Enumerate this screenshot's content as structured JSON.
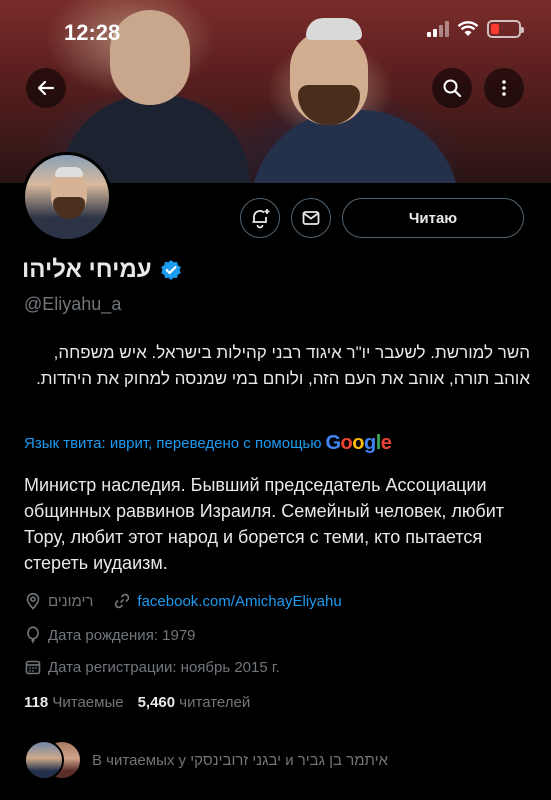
{
  "status_bar": {
    "time": "12:28"
  },
  "header": {
    "back_icon": "arrow-left-icon",
    "search_icon": "search-icon",
    "more_icon": "more-vertical-icon"
  },
  "profile": {
    "display_name": "עמיחי אליהו",
    "handle": "@Eliyahu_a",
    "follow_label": "Читаю",
    "bio_original": "השר למורשת. לשעבר יו\"ר איגוד רבני קהילות בישראל. איש משפחה, אוהב תורה, אוהב את העם הזה, ולוחם במי שמנסה למחוק את היהדות.",
    "translation_note": "Язык твита: иврит, переведено с помощью",
    "translation_brand": "Google",
    "bio_translated": "Министр наследия. Бывший председатель Ассоциации общинных раввинов Израиля. Семейный человек, любит Тору, любит этот народ и борется с теми, кто пытается стереть иудаизм.",
    "location": "רימונים",
    "website": "facebook.com/AmichayEliyahu",
    "birth_date": "Дата рождения: 1979",
    "joined": "Дата регистрации: ноябрь 2015 г.",
    "following_count": "118",
    "following_label": "Читаемые",
    "followers_count": "5,460",
    "followers_label": "читателей",
    "followed_by_text": "В читаемых у יבגני זרובינסקי и איתמר בן גביר"
  },
  "colors": {
    "accent": "#1d9bf0",
    "muted": "#71767b",
    "text": "#e7e9ea",
    "background": "#000000"
  }
}
